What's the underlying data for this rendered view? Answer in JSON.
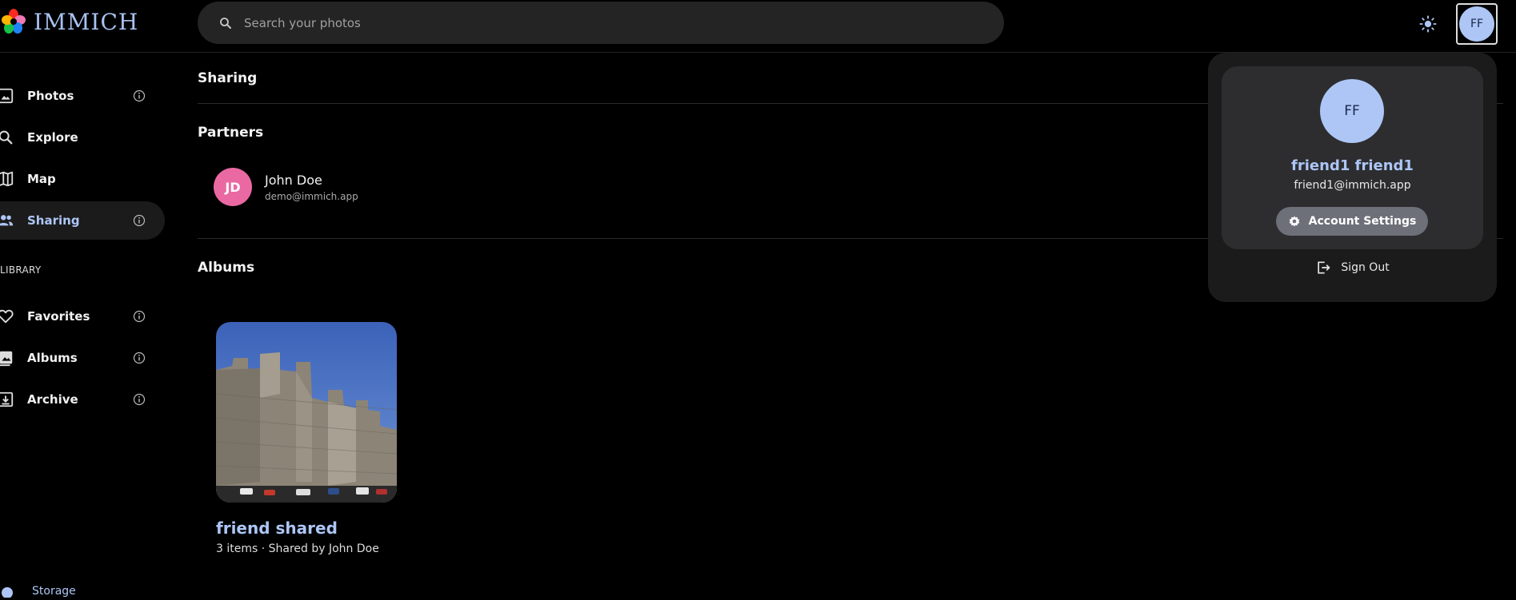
{
  "app": {
    "name": "IMMICH"
  },
  "search": {
    "placeholder": "Search your photos"
  },
  "user": {
    "initials": "FF",
    "name": "friend1 friend1",
    "email": "friend1@immich.app"
  },
  "sidebar": {
    "items": [
      {
        "label": "Photos"
      },
      {
        "label": "Explore"
      },
      {
        "label": "Map"
      },
      {
        "label": "Sharing"
      }
    ],
    "library_label": "LIBRARY",
    "library_items": [
      {
        "label": "Favorites"
      },
      {
        "label": "Albums"
      },
      {
        "label": "Archive"
      }
    ],
    "storage_label": "Storage"
  },
  "main": {
    "title": "Sharing",
    "partners_heading": "Partners",
    "partner": {
      "initials": "JD",
      "name": "John Doe",
      "email": "demo@immich.app"
    },
    "albums_heading": "Albums",
    "album": {
      "title": "friend shared",
      "meta": "3 items · Shared by John Doe"
    }
  },
  "account_menu": {
    "settings_label": "Account Settings",
    "signout_label": "Sign Out"
  },
  "colors": {
    "accent": "#adc6f6",
    "partner_avatar": "#ea69a3",
    "background": "#000000"
  }
}
